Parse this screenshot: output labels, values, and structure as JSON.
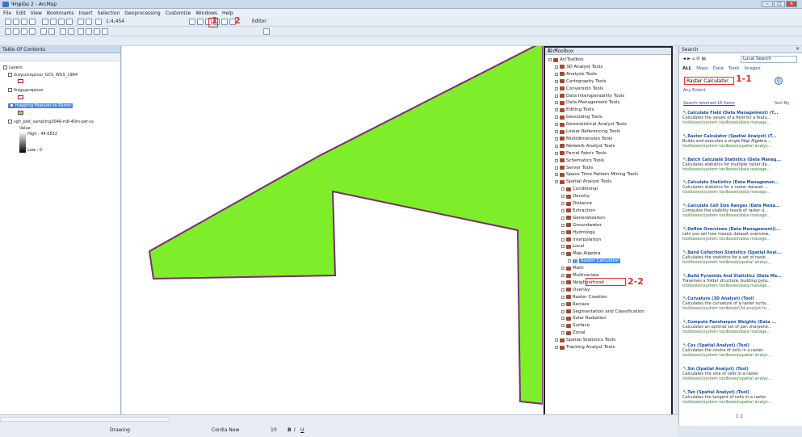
{
  "window": {
    "title": "Ψηφίδα 2 - ArcMap"
  },
  "menu": [
    "File",
    "Edit",
    "View",
    "Bookmarks",
    "Insert",
    "Selection",
    "Geoprocessing",
    "Customize",
    "Windows",
    "Help"
  ],
  "toolbar": {
    "scale": "1:4,454",
    "editor": "Editor"
  },
  "toc": {
    "title": "Table Of Contents",
    "layers_root": "Layers",
    "layers": [
      "διαγωνισμένοι_GCS_WGS_1984",
      "διαχωρισμένοι",
      "mapping Features to Raster",
      "sgh_plot_sampling3046-m8-40m-per-cs"
    ],
    "value_label": "Value",
    "high": "High : 44.6832",
    "low": "Low : 0"
  },
  "toolbox": {
    "title": "ArcToolbox",
    "root": "ArcToolbox",
    "items": [
      "3D Analyst Tools",
      "Analysis Tools",
      "Cartography Tools",
      "Conversion Tools",
      "Data Interoperability Tools",
      "Data Management Tools",
      "Editing Tools",
      "Geocoding Tools",
      "Geostatistical Analyst Tools",
      "Linear Referencing Tools",
      "Multidimension Tools",
      "Network Analyst Tools",
      "Parcel Fabric Tools",
      "Schematics Tools",
      "Server Tools",
      "Space Time Pattern Mining Tools",
      "Spatial Analyst Tools"
    ],
    "spatial": [
      "Conditional",
      "Density",
      "Distance",
      "Extraction",
      "Generalization",
      "Groundwater",
      "Hydrology",
      "Interpolation",
      "Local",
      "Map Algebra"
    ],
    "map_algebra_child": "Raster Calculator",
    "spatial2": [
      "Math",
      "Multivariate",
      "Neighborhood",
      "Overlay",
      "Raster Creation",
      "Reclass",
      "Segmentation and Classification",
      "Solar Radiation",
      "Surface",
      "Zonal"
    ],
    "tail": [
      "Spatial Statistics Tools",
      "Tracking Analyst Tools"
    ]
  },
  "search": {
    "title": "Search",
    "scope": "Local Search",
    "tabs": [
      "ALL",
      "Maps",
      "Data",
      "Tools",
      "Images"
    ],
    "query": "Raster Calculator",
    "any_extent": "Any Extent",
    "returned": "Search returned 16 items",
    "sort": "Sort By",
    "results": [
      {
        "t": "Calculate Field (Data Management) (T...",
        "d": "Calculates the values of a field for a featu...",
        "p": "toolboxes\\system toolboxes\\data manage..."
      },
      {
        "t": "Raster Calculator (Spatial Analyst) (T...",
        "d": "Builds and executes a single Map Algebra ...",
        "p": "toolboxes\\system toolboxes\\spatial analys..."
      },
      {
        "t": "Batch Calculate Statistics (Data Manag...",
        "d": "Calculates statistics for multiple raster da...",
        "p": "toolboxes\\system toolboxes\\data manage..."
      },
      {
        "t": "Calculate Statistics (Data Managemen...",
        "d": "Calculates statistics for a raster dataset ...",
        "p": "toolboxes\\system toolboxes\\data manage..."
      },
      {
        "t": "Calculate Cell Size Ranges (Data Mana...",
        "d": "Computes the visibility levels of raster d...",
        "p": "toolboxes\\system toolboxes\\data manage..."
      },
      {
        "t": "Define Overviews (Data Management)(...",
        "d": "Lets you set how mosaic dataset overview...",
        "p": "toolboxes\\system toolboxes\\data manage..."
      },
      {
        "t": "Band Collection Statistics (Spatial Anal...",
        "d": "Calculates the statistics for a set of raste...",
        "p": "toolboxes\\system toolboxes\\spatial analys..."
      },
      {
        "t": "Build Pyramids And Statistics (Data Ma...",
        "d": "Traverses a folder structure, building pyra...",
        "p": "toolboxes\\system toolboxes\\data manage..."
      },
      {
        "t": "Curvature (3D Analyst) (Tool)",
        "d": "Calculates the curvature of a raster surfa...",
        "p": "toolboxes\\system toolboxes\\3d analyst to..."
      },
      {
        "t": "Compute Pansharpen Weights (Data ...",
        "d": "Calculates an optimal set of pan sharpene...",
        "p": "toolboxes\\system toolboxes\\data manage..."
      },
      {
        "t": "Cos (Spatial Analyst) (Tool)",
        "d": "Calculates the cosine of cells in a raster.",
        "p": "toolboxes\\system toolboxes\\spatial analys..."
      },
      {
        "t": "Sin (Spatial Analyst) (Tool)",
        "d": "Calculates the sine of cells in a raster.",
        "p": "toolboxes\\system toolboxes\\spatial analys..."
      },
      {
        "t": "Tan (Spatial Analyst) (Tool)",
        "d": "Calculates the tangent of cells in a raster.",
        "p": "toolboxes\\system toolboxes\\spatial analys..."
      }
    ],
    "pager": "1 2"
  },
  "annotations": {
    "a1": "1",
    "a2": "2",
    "a11": "1-1",
    "a22": "2-2"
  },
  "status": {
    "drawing": "Drawing",
    "font": "Cordia New",
    "size": "10"
  },
  "colors": {
    "polygon": "#7fee2a",
    "outline": "#7a2c6e",
    "accent": "#e03030"
  }
}
